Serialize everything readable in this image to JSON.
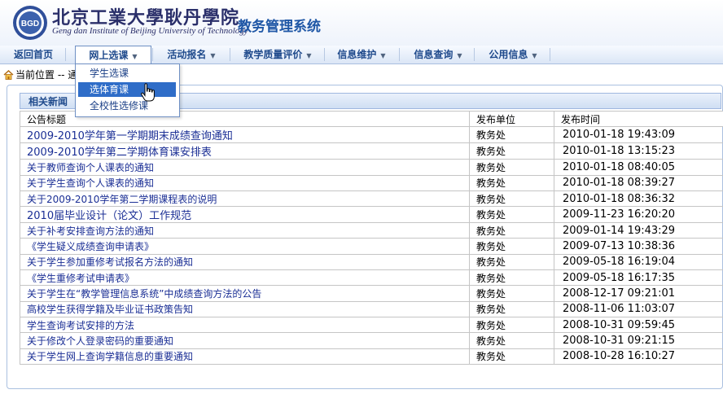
{
  "header": {
    "school_name": "北京工業大學耿丹學院",
    "school_name_en": "Geng dan Institute of Beijing University of Technology",
    "logo_text": "BGD",
    "system_title": "教务管理系统"
  },
  "nav": {
    "items": [
      {
        "label": "返回首页",
        "has_arrow": false
      },
      {
        "label": "网上选课",
        "has_arrow": true
      },
      {
        "label": "活动报名",
        "has_arrow": true
      },
      {
        "label": "教学质量评价",
        "has_arrow": true
      },
      {
        "label": "信息维护",
        "has_arrow": true
      },
      {
        "label": "信息查询",
        "has_arrow": true
      },
      {
        "label": "公用信息",
        "has_arrow": true
      }
    ],
    "arrow_glyph": "▼"
  },
  "dropdown": {
    "items": [
      {
        "label": "学生选课"
      },
      {
        "label": "选体育课"
      },
      {
        "label": "全校性选修课"
      }
    ]
  },
  "breadcrumb": {
    "text": "当前位置 -- 通知"
  },
  "panel": {
    "title": "相关新闻",
    "columns": [
      "公告标题",
      "发布单位",
      "发布时间"
    ],
    "rows": [
      {
        "title": "2009-2010学年第一学期期末成绩查询通知",
        "unit": "教务处",
        "time": "2010-01-18 19:43:09"
      },
      {
        "title": "2009-2010学年第二学期体育课安排表",
        "unit": "教务处",
        "time": "2010-01-18 13:15:23"
      },
      {
        "title": "关于教师查询个人课表的通知",
        "unit": "教务处",
        "time": "2010-01-18 08:40:05"
      },
      {
        "title": "关于学生查询个人课表的通知",
        "unit": "教务处",
        "time": "2010-01-18 08:39:27"
      },
      {
        "title": "关于2009-2010学年第二学期课程表的说明",
        "unit": "教务处",
        "time": "2010-01-18 08:36:32"
      },
      {
        "title": "2010届毕业设计（论文）工作规范",
        "unit": "教务处",
        "time": "2009-11-23 16:20:20"
      },
      {
        "title": "关于补考安排查询方法的通知",
        "unit": "教务处",
        "time": "2009-01-14 19:43:29"
      },
      {
        "title": "《学生疑义成绩查询申请表》",
        "unit": "教务处",
        "time": "2009-07-13 10:38:36"
      },
      {
        "title": "关于学生参加重修考试报名方法的通知",
        "unit": "教务处",
        "time": "2009-05-18 16:19:04"
      },
      {
        "title": "《学生重修考试申请表》",
        "unit": "教务处",
        "time": "2009-05-18 16:17:35"
      },
      {
        "title": "关于学生在“教学管理信息系统”中成绩查询方法的公告",
        "unit": "教务处",
        "time": "2008-12-17 09:21:01"
      },
      {
        "title": "高校学生获得学籍及毕业证书政策告知",
        "unit": "教务处",
        "time": "2008-11-06 11:03:07"
      },
      {
        "title": "学生查询考试安排的方法",
        "unit": "教务处",
        "time": "2008-10-31 09:59:45"
      },
      {
        "title": "关于修改个人登录密码的重要通知",
        "unit": "教务处",
        "time": "2008-10-31 09:21:15"
      },
      {
        "title": "关于学生网上查询学籍信息的重要通知",
        "unit": "教务处",
        "time": "2008-10-28 16:10:27"
      }
    ]
  },
  "colors": {
    "brand": "#1f57a6",
    "link": "#1b2f95",
    "highlight": "#2f6dc8"
  }
}
